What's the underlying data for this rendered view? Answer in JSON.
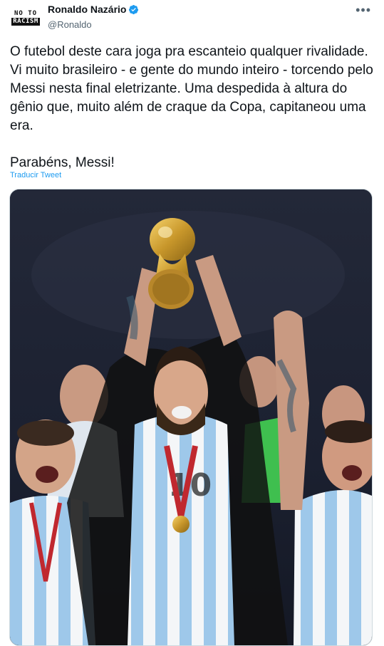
{
  "author": {
    "avatar_line1": "NO TO",
    "avatar_line2": "RACISM",
    "display_name": "Ronaldo Nazário",
    "handle": "@Ronaldo",
    "verified": true
  },
  "more_icon": "more-horizontal-icon",
  "tweet": {
    "text": "O futebol deste cara joga pra escanteio qualquer rivalidade. Vi muito brasileiro - e gente do mundo inteiro - torcendo pelo Messi nesta final eletrizante. Uma despedida à altura do gênio que, muito além de craque da Copa, capitaneou uma era.\n\nParabéns, Messi!",
    "translate_label": "Traducir Tweet"
  },
  "media": {
    "type": "photo"
  },
  "colors": {
    "link": "#1d9bf0",
    "verified": "#1d9bf0",
    "secondary_text": "#536471"
  }
}
